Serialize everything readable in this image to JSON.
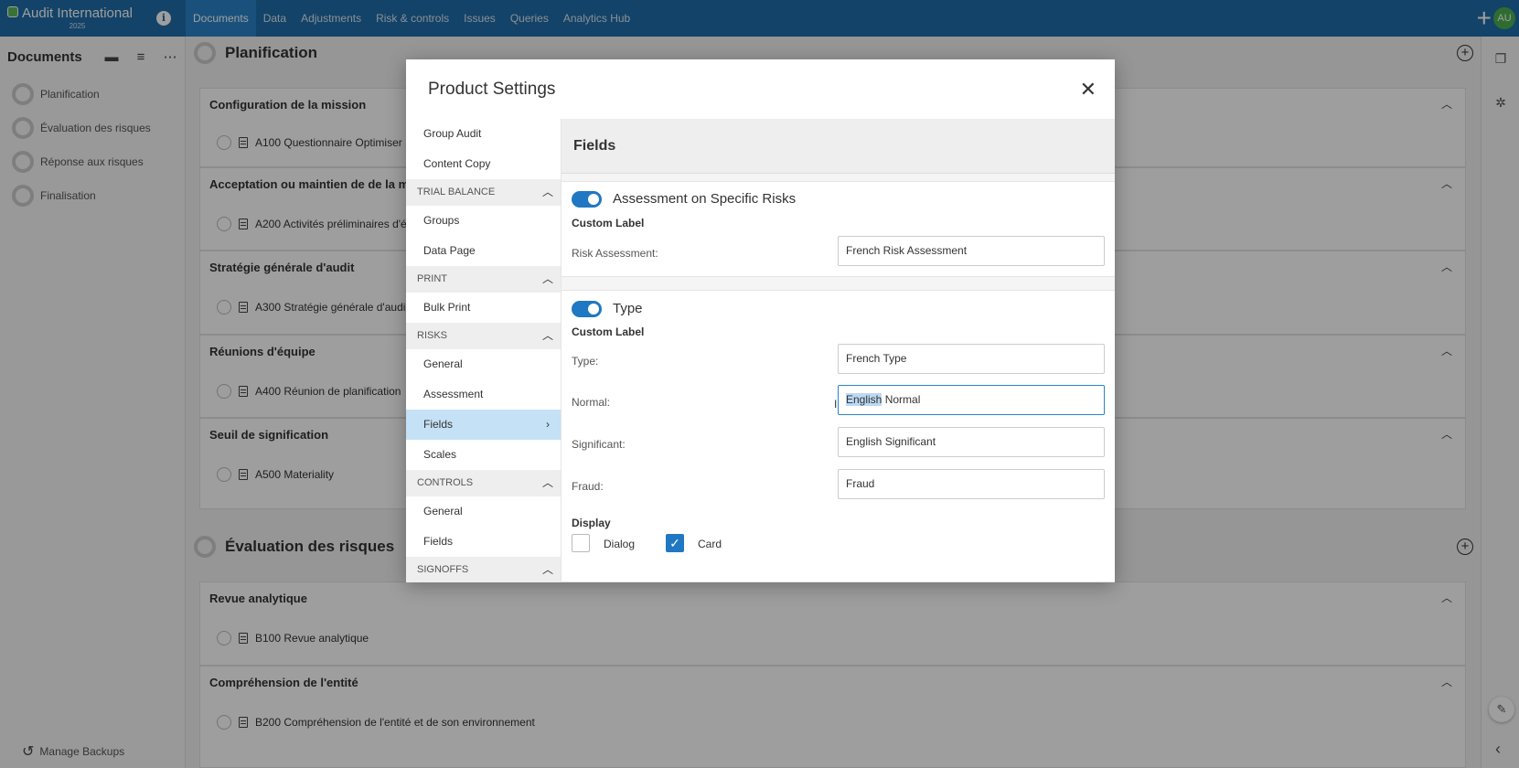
{
  "app": {
    "title": "Audit International",
    "year": "2025",
    "avatar": "AU"
  },
  "nav": [
    "Documents",
    "Data",
    "Adjustments",
    "Risk & controls",
    "Issues",
    "Queries",
    "Analytics Hub"
  ],
  "sidebar": {
    "title": "Documents",
    "items": [
      "Planification",
      "Évaluation des risques",
      "Réponse aux risques",
      "Finalisation"
    ],
    "footer": "Manage Backups"
  },
  "main": {
    "sections": [
      {
        "title": "Planification",
        "groups": [
          {
            "title": "Configuration de la mission",
            "doc": "A100 Questionnaire Optimiser"
          },
          {
            "title": "Acceptation ou maintien de de la mis",
            "doc": "A200 Activités préliminaires d'é"
          },
          {
            "title": "Stratégie générale d'audit",
            "doc": "A300 Stratégie générale d'audi"
          },
          {
            "title": "Réunions d'équipe",
            "doc": "A400 Réunion de planification"
          },
          {
            "title": "Seuil de signification",
            "doc": "A500 Materiality"
          }
        ]
      },
      {
        "title": "Évaluation des risques",
        "groups": [
          {
            "title": "Revue analytique",
            "doc": "B100 Revue analytique"
          },
          {
            "title": "Compréhension de l'entité",
            "doc": "B200 Compréhension de l'entité et de son environnement"
          }
        ]
      }
    ]
  },
  "modal": {
    "title": "Product Settings",
    "nav": {
      "top": [
        "Group Audit",
        "Content Copy"
      ],
      "trial_balance": {
        "label": "TRIAL BALANCE",
        "items": [
          "Groups",
          "Data Page"
        ]
      },
      "print": {
        "label": "PRINT",
        "items": [
          "Bulk Print"
        ]
      },
      "risks": {
        "label": "RISKS",
        "items": [
          "General",
          "Assessment",
          "Fields",
          "Scales"
        ]
      },
      "controls": {
        "label": "CONTROLS",
        "items": [
          "General",
          "Fields"
        ]
      },
      "signoffs": {
        "label": "SIGNOFFS"
      }
    },
    "content": {
      "header": "Fields",
      "assessment": {
        "toggle_label": "Assessment on Specific Risks",
        "enabled": true,
        "custom_label": "Custom Label",
        "risk_assessment_label": "Risk Assessment:",
        "risk_assessment_value": "French Risk Assessment"
      },
      "type": {
        "toggle_label": "Type",
        "enabled": true,
        "custom_label": "Custom Label",
        "type_label": "Type:",
        "type_value": "French Type",
        "normal_label": "Normal:",
        "normal_selected": "English",
        "normal_rest": " Normal",
        "significant_label": "Significant:",
        "significant_value": "English Significant",
        "fraud_label": "Fraud:",
        "fraud_value": "Fraud",
        "display_label": "Display",
        "dialog_label": "Dialog",
        "dialog_checked": false,
        "card_label": "Card",
        "card_checked": true
      }
    }
  },
  "colors": {
    "topbar": "#1f6ca8",
    "active_tab": "#2a84c8",
    "toggle": "#1f78c1",
    "active_nav": "#c5e1f5"
  }
}
